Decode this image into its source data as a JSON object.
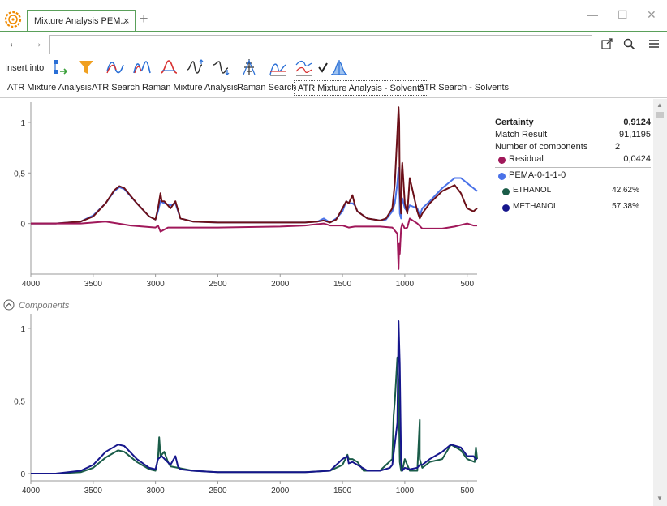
{
  "app": {
    "tab_title": "Mixture Analysis PEM...",
    "tab_close": "×",
    "new_tab": "+",
    "window_buttons": {
      "minimize": "—",
      "maximize": "☐",
      "close": "✕"
    }
  },
  "nav": {
    "back": "←",
    "forward": "→",
    "address_value": "",
    "icons": [
      "open-external-icon",
      "search-icon",
      "menu-icon"
    ]
  },
  "toolbar": {
    "insert_label": "Insert into",
    "icons": [
      "insert-structure-icon",
      "filter-icon",
      "baseline-icon",
      "peak-fit-icon",
      "smooth-icon",
      "normalize-icon",
      "derivative-icon",
      "peak-pick-icon",
      "overlay-icon",
      "stack-icon",
      "check-icon",
      "spectrum-icon"
    ],
    "accent_blue": "#2a6fd6",
    "accent_orange": "#f0a020"
  },
  "content_tabs": [
    {
      "label": "ATR Mixture Analysis",
      "active": false
    },
    {
      "label": "ATR Search",
      "active": false
    },
    {
      "label": "Raman Mixture Analysis",
      "active": false
    },
    {
      "label": "Raman Search",
      "active": false
    },
    {
      "label": "ATR Mixture Analysis - Solvents",
      "active": true
    },
    {
      "label": "ATR Search - Solvents",
      "active": false
    }
  ],
  "results": {
    "certainty_label": "Certainty",
    "certainty_value": "0,9124",
    "match_label": "Match Result",
    "match_value": "91,1195",
    "components_label": "Number of components",
    "components_value": "2",
    "residual_label": "Residual",
    "residual_value": "0,0424",
    "residual_color": "#a0185a",
    "query_label": "PEMA-0-1-1-0",
    "query_color": "#4a72e8",
    "components": [
      {
        "name": "ETHANOL",
        "percent": "42.62%",
        "color": "#1a5c48"
      },
      {
        "name": "METHANOL",
        "percent": "57.38%",
        "color": "#16168c"
      }
    ]
  },
  "components_section_label": "Components",
  "chart_data": [
    {
      "type": "line",
      "xlim": [
        4000,
        420
      ],
      "ylim": [
        -0.5,
        1.2
      ],
      "xticks": [
        4000,
        3500,
        3000,
        2500,
        2000,
        1500,
        1000,
        500
      ],
      "xtick_labels": [
        "4000",
        "3500",
        "3000",
        "2500",
        "2000",
        "1500",
        "1000",
        "500"
      ],
      "yticks": [
        0,
        0.5,
        1
      ],
      "ytick_labels": [
        "0",
        "0,5",
        "1"
      ],
      "series": [
        {
          "name": "PEMA-0-1-1-0",
          "color": "#4a72e8",
          "x": [
            4000,
            3800,
            3600,
            3500,
            3400,
            3330,
            3290,
            3250,
            3150,
            3050,
            3000,
            2980,
            2960,
            2930,
            2880,
            2840,
            2800,
            2700,
            2500,
            2000,
            1800,
            1700,
            1650,
            1600,
            1550,
            1500,
            1470,
            1450,
            1420,
            1400,
            1380,
            1300,
            1200,
            1150,
            1100,
            1080,
            1060,
            1050,
            1045,
            1040,
            1030,
            1025,
            1020,
            1000,
            980,
            960,
            900,
            880,
            860,
            800,
            700,
            600,
            550,
            500,
            450,
            420
          ],
          "y": [
            0,
            0,
            0.02,
            0.08,
            0.2,
            0.32,
            0.36,
            0.34,
            0.2,
            0.07,
            0.04,
            0.12,
            0.22,
            0.2,
            0.18,
            0.2,
            0.05,
            0.02,
            0.01,
            0.01,
            0.01,
            0.02,
            0.05,
            0.01,
            0.05,
            0.12,
            0.22,
            0.2,
            0.2,
            0.18,
            0.12,
            0.05,
            0.03,
            0.04,
            0.12,
            0.2,
            0.4,
            0.55,
            0.52,
            0.1,
            0.05,
            0.2,
            0.25,
            0.15,
            0.12,
            0.18,
            0.15,
            0.08,
            0.15,
            0.22,
            0.35,
            0.45,
            0.45,
            0.4,
            0.35,
            0.32
          ]
        },
        {
          "name": "",
          "color": "#6b0f18",
          "x": [
            4000,
            3800,
            3600,
            3500,
            3400,
            3330,
            3290,
            3250,
            3150,
            3050,
            3000,
            2980,
            2960,
            2950,
            2930,
            2880,
            2840,
            2800,
            2700,
            2500,
            2000,
            1800,
            1700,
            1650,
            1600,
            1550,
            1500,
            1470,
            1450,
            1420,
            1400,
            1380,
            1300,
            1200,
            1150,
            1100,
            1080,
            1060,
            1050,
            1045,
            1040,
            1030,
            1025,
            1020,
            1000,
            980,
            960,
            900,
            880,
            860,
            800,
            700,
            600,
            550,
            500,
            450,
            420
          ],
          "y": [
            0,
            0,
            0.02,
            0.07,
            0.2,
            0.33,
            0.37,
            0.35,
            0.2,
            0.07,
            0.04,
            0.15,
            0.3,
            0.22,
            0.22,
            0.15,
            0.22,
            0.05,
            0.02,
            0.01,
            0.01,
            0.01,
            0.02,
            0.03,
            0.01,
            0.04,
            0.15,
            0.22,
            0.2,
            0.28,
            0.18,
            0.12,
            0.05,
            0.03,
            0.05,
            0.15,
            0.4,
            0.9,
            1.15,
            1.0,
            0.3,
            0.1,
            0.5,
            0.6,
            0.2,
            0.1,
            0.45,
            0.12,
            0.05,
            0.1,
            0.2,
            0.32,
            0.38,
            0.3,
            0.15,
            0.12,
            0.15
          ]
        },
        {
          "name": "Residual",
          "color": "#a0185a",
          "x": [
            4000,
            3800,
            3600,
            3400,
            3300,
            3200,
            3000,
            2980,
            2960,
            2900,
            2700,
            2500,
            2000,
            1800,
            1650,
            1600,
            1500,
            1450,
            1400,
            1300,
            1200,
            1100,
            1060,
            1050,
            1045,
            1040,
            1030,
            1020,
            1000,
            980,
            960,
            900,
            860,
            800,
            700,
            600,
            500,
            450,
            420
          ],
          "y": [
            0,
            0,
            0,
            0.02,
            0,
            -0.02,
            -0.04,
            -0.02,
            -0.08,
            -0.04,
            -0.04,
            -0.04,
            -0.03,
            -0.02,
            0,
            -0.02,
            -0.02,
            -0.04,
            -0.03,
            -0.03,
            -0.03,
            -0.04,
            -0.1,
            -0.45,
            -0.2,
            -0.3,
            -0.05,
            0,
            -0.05,
            -0.04,
            0.05,
            0,
            -0.05,
            -0.05,
            -0.05,
            -0.03,
            0,
            -0.02,
            -0.02
          ]
        }
      ]
    },
    {
      "type": "line",
      "xlim": [
        4000,
        420
      ],
      "ylim": [
        -0.05,
        1.1
      ],
      "xticks": [
        4000,
        3500,
        3000,
        2500,
        2000,
        1500,
        1000,
        500
      ],
      "xtick_labels": [
        "4000",
        "3500",
        "3000",
        "2500",
        "2000",
        "1500",
        "1000",
        "500"
      ],
      "yticks": [
        0,
        0.5,
        1
      ],
      "ytick_labels": [
        "0",
        "0,5",
        "1"
      ],
      "series": [
        {
          "name": "ETHANOL",
          "color": "#1a5c48",
          "x": [
            4000,
            3800,
            3600,
            3500,
            3400,
            3300,
            3250,
            3150,
            3050,
            3000,
            2980,
            2970,
            2960,
            2930,
            2900,
            2880,
            2700,
            2500,
            2000,
            1800,
            1600,
            1500,
            1460,
            1450,
            1420,
            1380,
            1330,
            1200,
            1100,
            1090,
            1080,
            1060,
            1050,
            1045,
            1040,
            1030,
            1020,
            1000,
            960,
            900,
            880,
            880,
            860,
            800,
            700,
            630,
            550,
            500,
            440,
            430,
            420
          ],
          "y": [
            0,
            0,
            0.01,
            0.04,
            0.11,
            0.16,
            0.15,
            0.08,
            0.03,
            0.02,
            0.1,
            0.25,
            0.12,
            0.15,
            0.08,
            0.05,
            0.02,
            0.01,
            0.01,
            0.01,
            0.02,
            0.06,
            0.13,
            0.1,
            0.1,
            0.08,
            0.02,
            0.02,
            0.1,
            0.4,
            0.5,
            0.8,
            0.62,
            0.3,
            0.08,
            0.02,
            0.02,
            0.1,
            0.02,
            0.02,
            0.37,
            0.1,
            0.04,
            0.08,
            0.1,
            0.2,
            0.16,
            0.1,
            0.08,
            0.18,
            0.1
          ]
        },
        {
          "name": "METHANOL",
          "color": "#16168c",
          "x": [
            4000,
            3800,
            3600,
            3500,
            3400,
            3300,
            3250,
            3150,
            3050,
            3000,
            2980,
            2950,
            2880,
            2840,
            2820,
            2800,
            2700,
            2500,
            2000,
            1800,
            1600,
            1500,
            1460,
            1450,
            1420,
            1400,
            1300,
            1200,
            1120,
            1100,
            1060,
            1050,
            1040,
            1030,
            1025,
            1020,
            1000,
            960,
            900,
            880,
            860,
            800,
            700,
            630,
            550,
            500,
            450,
            430,
            420
          ],
          "y": [
            0,
            0,
            0.02,
            0.06,
            0.15,
            0.2,
            0.19,
            0.1,
            0.04,
            0.03,
            0.1,
            0.12,
            0.06,
            0.12,
            0.05,
            0.03,
            0.02,
            0.01,
            0.01,
            0.01,
            0.02,
            0.1,
            0.12,
            0.07,
            0.08,
            0.07,
            0.02,
            0.02,
            0.04,
            0.06,
            0.35,
            1.05,
            0.75,
            0.1,
            0.05,
            0.02,
            0.04,
            0.03,
            0.04,
            0.06,
            0.06,
            0.1,
            0.15,
            0.2,
            0.18,
            0.12,
            0.12,
            0.1,
            0.1
          ]
        }
      ]
    }
  ]
}
